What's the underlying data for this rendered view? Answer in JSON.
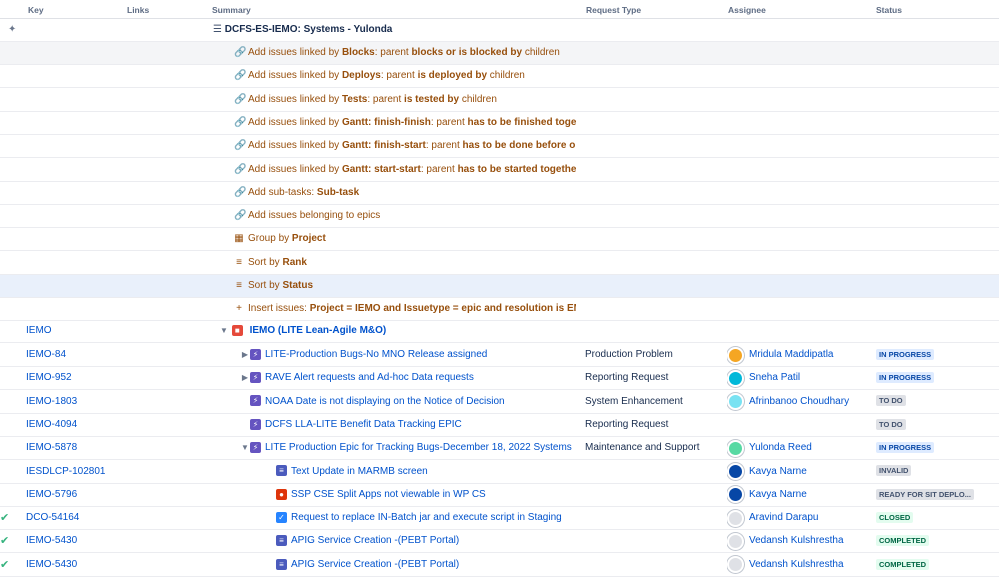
{
  "headers": {
    "key": "Key",
    "links": "Links",
    "summary": "Summary",
    "request_type": "Request Type",
    "assignee": "Assignee",
    "status": "Status"
  },
  "top": {
    "title": "DCFS-ES-IEMO: Systems - Yulonda"
  },
  "generators": [
    {
      "pre": "Add issues linked by ",
      "b1": "Blocks",
      "mid": ": parent ",
      "b2": "blocks or is blocked by",
      "post": " children"
    },
    {
      "pre": "Add issues linked by ",
      "b1": "Deploys",
      "mid": ": parent ",
      "b2": "is deployed by",
      "post": " children"
    },
    {
      "pre": "Add issues linked by ",
      "b1": "Tests",
      "mid": ": parent ",
      "b2": "is tested by",
      "post": " children"
    },
    {
      "pre": "Add issues linked by ",
      "b1": "Gantt: finish-finish",
      "mid": ": parent ",
      "b2": "has to be finished toget",
      "post": ""
    },
    {
      "pre": "Add issues linked by ",
      "b1": "Gantt: finish-start",
      "mid": ": parent ",
      "b2": "has to be done before o",
      "post": ""
    },
    {
      "pre": "Add issues linked by ",
      "b1": "Gantt: start-start",
      "mid": ": parent ",
      "b2": "has to be started togethe",
      "post": ""
    },
    {
      "pre": "Add sub-tasks: ",
      "b1": "Sub-task",
      "mid": "",
      "b2": "",
      "post": ""
    },
    {
      "pre": "Add issues belonging to epics",
      "b1": "",
      "mid": "",
      "b2": "",
      "post": ""
    },
    {
      "pre": "Group by ",
      "b1": "Project",
      "mid": "",
      "b2": "",
      "post": ""
    },
    {
      "pre": "Sort by ",
      "b1": "Rank",
      "mid": "",
      "b2": "",
      "post": ""
    },
    {
      "pre": "Sort by ",
      "b1": "Status",
      "mid": "",
      "b2": "",
      "post": ""
    },
    {
      "pre": "Insert issues: ",
      "b1": "Project = IEMO and Issuetype = epic and resolution is EM",
      "mid": "",
      "b2": "",
      "post": ""
    }
  ],
  "project": {
    "key": "IEMO",
    "title": "IEMO (LITE Lean-Agile M&O)"
  },
  "issues": [
    {
      "key": "IEMO-84",
      "summary": "LITE-Production Bugs-No MNO Release assigned",
      "request_type": "Production Problem",
      "assignee": "Mridula Maddipatla",
      "status": "IN PROGRESS"
    },
    {
      "key": "IEMO-952",
      "summary": "RAVE Alert requests and Ad-hoc Data requests",
      "request_type": "Reporting Request",
      "assignee": "Sneha Patil",
      "status": "IN PROGRESS"
    },
    {
      "key": "IEMO-1803",
      "summary": "NOAA Date is not displaying on the Notice of Decision",
      "request_type": "System Enhancement",
      "assignee": "Afrinbanoo Choudhary",
      "status": "TO DO"
    },
    {
      "key": "IEMO-4094",
      "summary": "DCFS LLA-LITE Benefit Data Tracking EPIC",
      "request_type": "Reporting Request",
      "assignee": "",
      "status": "TO DO"
    },
    {
      "key": "IEMO-5878",
      "summary": "LITE Production Epic for Tracking Bugs-December 18, 2022 Systems N",
      "request_type": "Maintenance and Support",
      "assignee": "Yulonda Reed",
      "status": "IN PROGRESS"
    },
    {
      "key": "IESDLCP-102801",
      "summary": "Text Update in MARMB screen",
      "request_type": "",
      "assignee": "Kavya Narne",
      "status": "INVALID"
    },
    {
      "key": "IEMO-5796",
      "summary": "SSP CSE Split Apps not viewable in WP CS",
      "request_type": "",
      "assignee": "Kavya Narne",
      "status": "READY FOR SIT DEPLO..."
    },
    {
      "key": "DCO-54164",
      "summary": "Request to replace IN-Batch jar and execute script in Staging",
      "request_type": "",
      "assignee": "Aravind Darapu",
      "status": "CLOSED"
    },
    {
      "key": "IEMO-5430",
      "summary": "APIG Service Creation -(PEBT Portal)",
      "request_type": "",
      "assignee": "Vedansh Kulshrestha",
      "status": "COMPLETED"
    },
    {
      "key": "IEMO-5430",
      "summary": "APIG Service Creation -(PEBT Portal)",
      "request_type": "",
      "assignee": "Vedansh Kulshrestha",
      "status": "COMPLETED"
    }
  ],
  "colors": {
    "link_blue": "#0052cc",
    "generator_brown": "#974f0c",
    "in_progress_bg": "#deebff",
    "done_bg": "#e3fcef",
    "todo_bg": "#dfe1e6"
  }
}
